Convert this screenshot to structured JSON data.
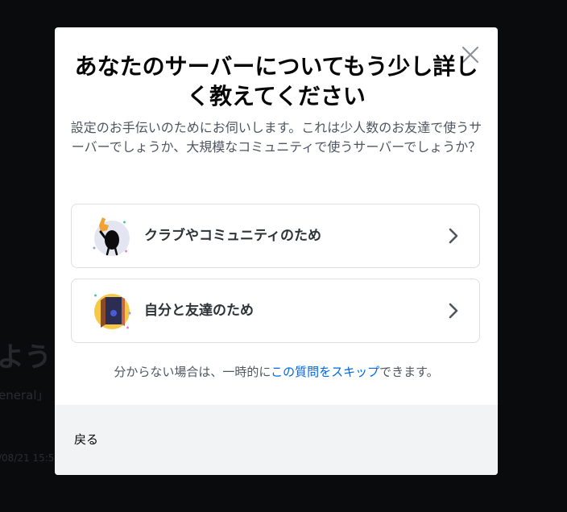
{
  "background": {
    "heading": "よう",
    "channel": "eneral」",
    "date": "/08/21 15:5"
  },
  "modal": {
    "title": "あなたのサーバーについてもう少し詳しく教えてください",
    "subtitle": "設定のお手伝いのためにお伺いします。これは少人数のお友達で使うサーバーでしょうか、大規模なコミュニティで使うサーバーでしょうか？",
    "options": [
      {
        "label": "クラブやコミュニティのため",
        "icon": "club-community-icon"
      },
      {
        "label": "自分と友達のため",
        "icon": "friends-door-icon"
      }
    ],
    "skip_prefix": "分からない場合は、一時的に",
    "skip_link": "この質問をスキップ",
    "skip_suffix": "できます。",
    "back_label": "戻る"
  },
  "colors": {
    "overlay": "#0a0b0d",
    "title": "#060607",
    "text_muted": "#4f5660",
    "link": "#0068e0",
    "footer_bg": "#f2f3f5"
  }
}
